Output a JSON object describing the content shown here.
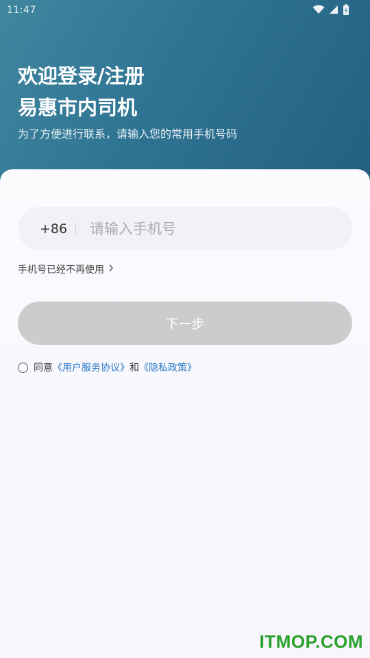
{
  "status_bar": {
    "time": "11:47",
    "icons": [
      "wifi-icon",
      "signal-icon",
      "battery-icon"
    ]
  },
  "header": {
    "title_line1": "欢迎登录/注册",
    "title_line2": "易惠市内司机",
    "subtitle": "为了方便进行联系，请输入您的常用手机号码"
  },
  "form": {
    "country_code": "+86",
    "phone_placeholder": "请输入手机号",
    "phone_value": "",
    "no_longer_used_label": "手机号已经不再使用",
    "next_button_label": "下一步"
  },
  "agreement": {
    "prefix": "同意",
    "user_agreement": "《用户服务协议》",
    "conjunction": "和",
    "privacy_policy": "《隐私政策》"
  },
  "watermark": "ITMOP.COM",
  "colors": {
    "header_start": "#3f879f",
    "header_end": "#235f80",
    "link": "#2a78c6",
    "button_disabled": "#cccccc",
    "watermark": "#2aa02a"
  }
}
